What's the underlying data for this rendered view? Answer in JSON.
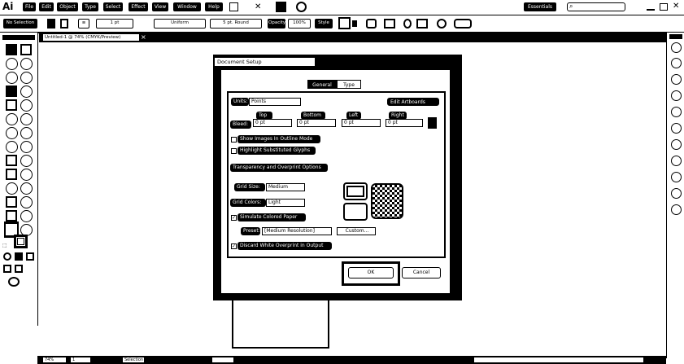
{
  "app": {
    "logo": "Ai"
  },
  "menu": [
    "File",
    "Edit",
    "Object",
    "Type",
    "Select",
    "Effect",
    "View",
    "Window",
    "Help"
  ],
  "workspace": {
    "label": "Essentials",
    "search_placeholder": ""
  },
  "control_bar": {
    "selection_label": "No Selection",
    "stroke_weight": "1 pt",
    "profile": "Uniform",
    "brush": "5 pt. Round",
    "opacity_label": "Opacity",
    "opacity_value": "100%",
    "style_label": "Style"
  },
  "document_tab": {
    "title": "Untitled-1 @ 74% (CMYK/Preview)",
    "close": "×"
  },
  "dialog": {
    "title": "Document Setup",
    "tabs": [
      "General",
      "Type"
    ],
    "units_label": "Units:",
    "units_value": "Points",
    "edit_artboards": "Edit Artboards",
    "bleed_label": "Bleed:",
    "bleed": [
      {
        "label": "Top",
        "value": "0 pt"
      },
      {
        "label": "Bottom",
        "value": "0 pt"
      },
      {
        "label": "Left",
        "value": "0 pt"
      },
      {
        "label": "Right",
        "value": "0 pt"
      }
    ],
    "show_images_outline": "Show Images In Outline Mode",
    "highlight_glyphs": "Highlight Substituted Glyphs",
    "transparency_header": "Transparency and Overprint Options",
    "grid_size_label": "Grid Size:",
    "grid_size_value": "Medium",
    "grid_colors_label": "Grid Colors:",
    "grid_colors_value": "Light",
    "simulate_paper": "Simulate Colored Paper",
    "preset_label": "Preset:",
    "preset_value": "[Medium Resolution]",
    "custom_button": "Custom...",
    "discard_white": "Discard White Overprint in Output",
    "ok": "OK",
    "cancel": "Cancel"
  },
  "status": {
    "zoom": "74%",
    "artboard": "1",
    "mode": "Selection"
  }
}
